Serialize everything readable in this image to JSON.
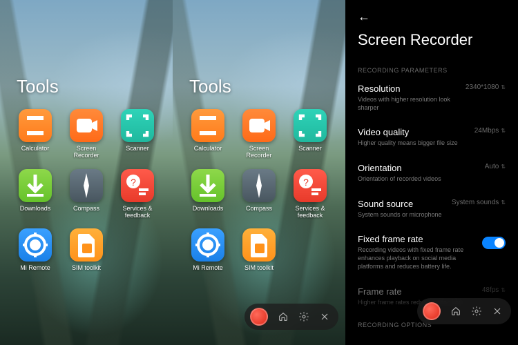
{
  "folder_title": "Tools",
  "apps": [
    {
      "label": "Calculator",
      "icon": "calculator-icon"
    },
    {
      "label": "Screen Recorder",
      "icon": "screen-recorder-icon"
    },
    {
      "label": "Scanner",
      "icon": "scanner-icon"
    },
    {
      "label": "Downloads",
      "icon": "downloads-icon"
    },
    {
      "label": "Compass",
      "icon": "compass-icon"
    },
    {
      "label": "Services & feedback",
      "icon": "feedback-icon"
    },
    {
      "label": "Mi Remote",
      "icon": "remote-icon"
    },
    {
      "label": "SIM toolkit",
      "icon": "sim-icon"
    }
  ],
  "recorder_toolbar": {
    "record": "record-button",
    "home": "home-icon",
    "settings": "settings-icon",
    "close": "close-icon"
  },
  "settings": {
    "title": "Screen Recorder",
    "section_params": "RECORDING PARAMETERS",
    "section_options": "RECORDING OPTIONS",
    "rows": {
      "resolution": {
        "title": "Resolution",
        "sub": "Videos with higher resolution look sharper",
        "value": "2340*1080"
      },
      "video_quality": {
        "title": "Video quality",
        "sub": "Higher quality means bigger file size",
        "value": "24Mbps"
      },
      "orientation": {
        "title": "Orientation",
        "sub": "Orientation of recorded videos",
        "value": "Auto"
      },
      "sound_source": {
        "title": "Sound source",
        "sub": "System sounds or microphone",
        "value": "System sounds"
      },
      "fixed_fps": {
        "title": "Fixed frame rate",
        "sub": "Recording videos with fixed frame rate enhances playback on social media platforms and reduces battery life.",
        "on": true
      },
      "frame_rate": {
        "title": "Frame rate",
        "sub": "Higher frame rates reduce motion blur",
        "value": "48fps"
      }
    }
  }
}
